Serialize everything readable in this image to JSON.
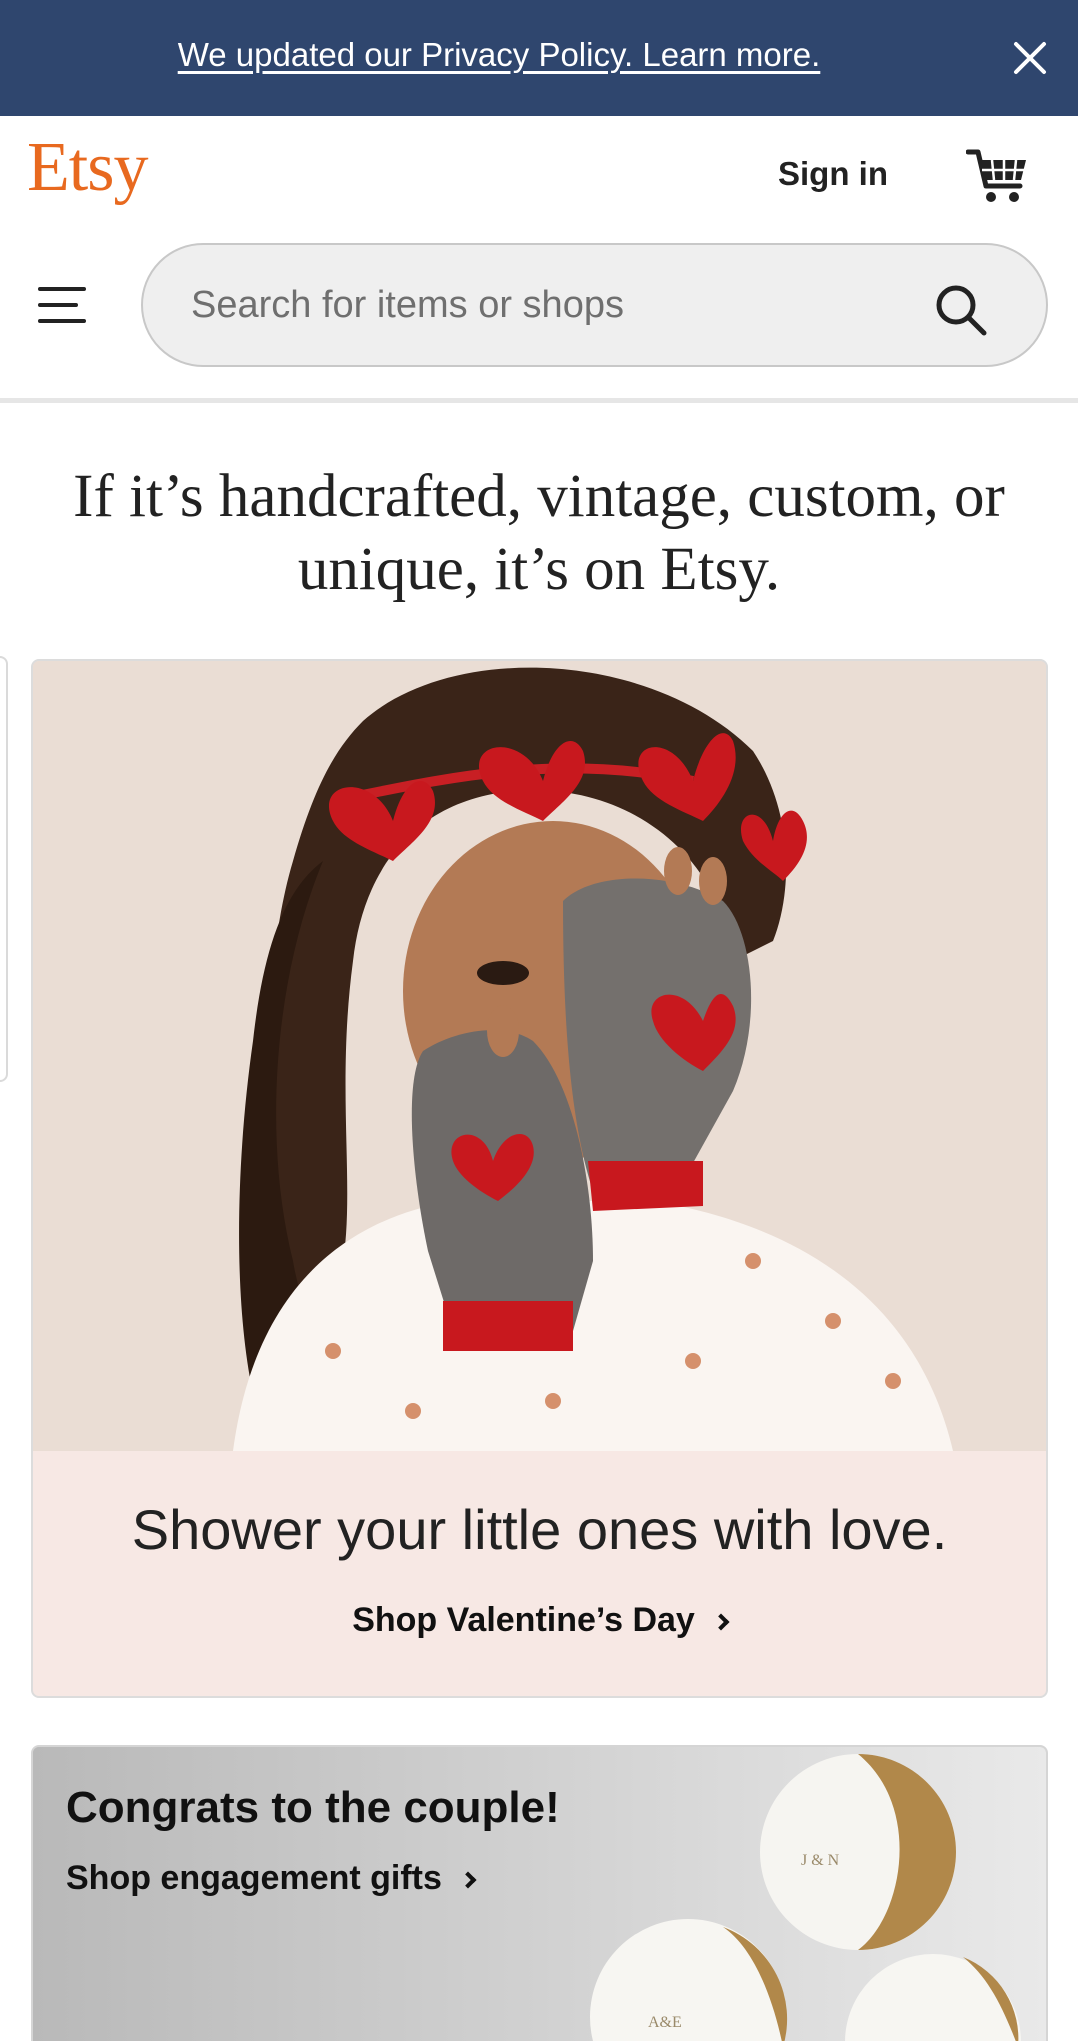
{
  "banner": {
    "text": "We updated our Privacy Policy. Learn more.",
    "close_icon": "close-icon"
  },
  "header": {
    "logo": "Etsy",
    "sign_in": "Sign in",
    "cart_icon": "cart-icon",
    "menu_icon": "hamburger-menu-icon"
  },
  "search": {
    "placeholder": "Search for items or shops",
    "value": "",
    "icon": "search-icon"
  },
  "hero": {
    "tagline": "If it’s handcrafted, vintage, custom, or unique, it’s on Etsy."
  },
  "cards": [
    {
      "caption": "Shower your little ones with love.",
      "cta": "Shop Valentine’s Day",
      "background": "#f7e8e4"
    },
    {
      "title": "Congrats to the couple!",
      "cta": "Shop engagement gifts",
      "dish_text_1": "J & N",
      "dish_text_2": "A&E"
    }
  ],
  "colors": {
    "banner": "#2f466e",
    "brand": "#e8691f",
    "card_pink": "#f7e8e4"
  }
}
